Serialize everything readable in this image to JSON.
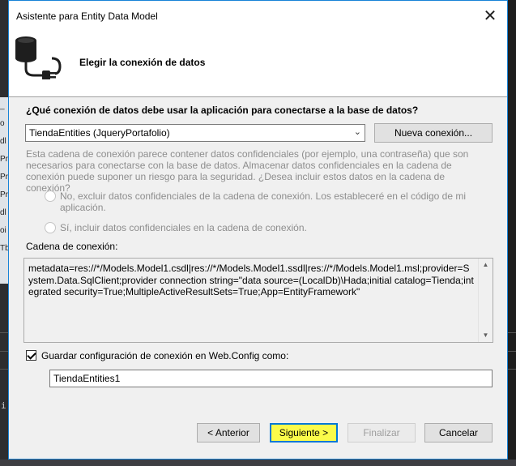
{
  "dialog": {
    "title": "Asistente para Entity Data Model",
    "close_label": "✕",
    "header": "Elegir la conexión de datos"
  },
  "connection": {
    "question": "¿Qué conexión de datos debe usar la aplicación para conectarse a la base de datos?",
    "selected": "TiendaEntities (JqueryPortafolio)",
    "new_button": "Nueva conexión...",
    "warning": "Esta cadena de conexión parece contener datos confidenciales (por ejemplo, una contraseña) que son necesarios para conectarse con la base de datos. Almacenar datos confidenciales en la cadena de conexión puede suponer un riesgo para la seguridad. ¿Desea incluir estos datos en la cadena de conexión?",
    "option_no": "No, excluir datos confidenciales de la cadena de conexión. Los estableceré en el código de mi aplicación.",
    "option_yes": "Sí, incluir datos confidenciales en la cadena de conexión.",
    "string_label": "Cadena de conexión:",
    "string_value": "metadata=res://*/Models.Model1.csdl|res://*/Models.Model1.ssdl|res://*/Models.Model1.msl;provider=System.Data.SqlClient;provider connection string=\"data source=(LocalDb)\\Hada;initial catalog=Tienda;integrated security=True;MultipleActiveResultSets=True;App=EntityFramework\"",
    "save_label": "Guardar configuración de conexión en Web.Config como:",
    "save_checked": true,
    "config_name": "TiendaEntities1"
  },
  "buttons": {
    "previous": "< Anterior",
    "next": "Siguiente >",
    "finish": "Finalizar",
    "cancel": "Cancelar"
  },
  "background": {
    "left_fragments": [
      "_",
      "o",
      "dl",
      "Pr",
      "Pr",
      "Pr",
      "dl",
      "oi",
      "Tb"
    ],
    "caret": "i"
  },
  "icons": {
    "header": "database-plug-icon",
    "combo": "chevron-down-icon",
    "scroll_up": "scroll-up-arrow-icon",
    "scroll_down": "scroll-down-arrow-icon"
  },
  "colors": {
    "dialog_border": "#1883d7",
    "next_highlight": "#fbfb4a",
    "disabled_text": "#8d8d8d"
  }
}
